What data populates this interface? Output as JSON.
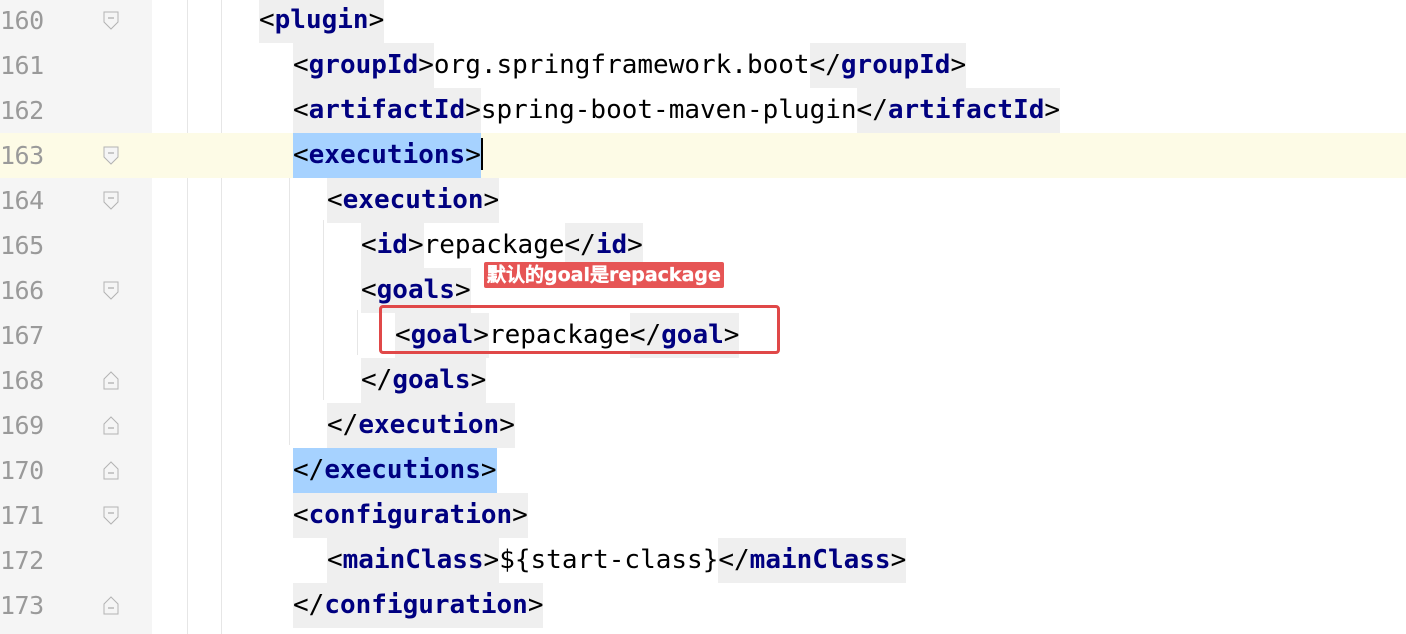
{
  "editor": {
    "current_line": "163",
    "lines": [
      {
        "num": "160",
        "fold": "open",
        "parts": [
          [
            "<",
            "punct"
          ],
          [
            "plugin",
            "tag"
          ],
          [
            ">",
            "punct"
          ]
        ]
      },
      {
        "num": "161",
        "fold": "none",
        "parts": [
          [
            "<",
            "punct"
          ],
          [
            "groupId",
            "tag"
          ],
          [
            ">",
            "punct"
          ],
          [
            "org.springframework.boot",
            "text"
          ],
          [
            "</",
            "punct"
          ],
          [
            "groupId",
            "tag"
          ],
          [
            ">",
            "punct"
          ]
        ]
      },
      {
        "num": "162",
        "fold": "none",
        "parts": [
          [
            "<",
            "punct"
          ],
          [
            "artifactId",
            "tag"
          ],
          [
            ">",
            "punct"
          ],
          [
            "spring-boot-maven-plugin",
            "text"
          ],
          [
            "</",
            "punct"
          ],
          [
            "artifactId",
            "tag"
          ],
          [
            ">",
            "punct"
          ]
        ]
      },
      {
        "num": "163",
        "fold": "open",
        "parts": [
          [
            "<",
            "punct"
          ],
          [
            "executions",
            "tag"
          ],
          [
            ">",
            "punct"
          ]
        ]
      },
      {
        "num": "164",
        "fold": "open",
        "parts": [
          [
            "<",
            "punct"
          ],
          [
            "execution",
            "tag"
          ],
          [
            ">",
            "punct"
          ]
        ]
      },
      {
        "num": "165",
        "fold": "none",
        "parts": [
          [
            "<",
            "punct"
          ],
          [
            "id",
            "tag"
          ],
          [
            ">",
            "punct"
          ],
          [
            "repackage",
            "text"
          ],
          [
            "</",
            "punct"
          ],
          [
            "id",
            "tag"
          ],
          [
            ">",
            "punct"
          ]
        ]
      },
      {
        "num": "166",
        "fold": "open",
        "parts": [
          [
            "<",
            "punct"
          ],
          [
            "goals",
            "tag"
          ],
          [
            ">",
            "punct"
          ]
        ]
      },
      {
        "num": "167",
        "fold": "none",
        "parts": [
          [
            "<",
            "punct"
          ],
          [
            "goal",
            "tag"
          ],
          [
            ">",
            "punct"
          ],
          [
            "repackage",
            "text"
          ],
          [
            "</",
            "punct"
          ],
          [
            "goal",
            "tag"
          ],
          [
            ">",
            "punct"
          ]
        ]
      },
      {
        "num": "168",
        "fold": "close",
        "parts": [
          [
            "</",
            "punct"
          ],
          [
            "goals",
            "tag"
          ],
          [
            ">",
            "punct"
          ]
        ]
      },
      {
        "num": "169",
        "fold": "close",
        "parts": [
          [
            "</",
            "punct"
          ],
          [
            "execution",
            "tag"
          ],
          [
            ">",
            "punct"
          ]
        ]
      },
      {
        "num": "170",
        "fold": "close",
        "parts": [
          [
            "</",
            "punct"
          ],
          [
            "executions",
            "tag"
          ],
          [
            ">",
            "punct"
          ]
        ]
      },
      {
        "num": "171",
        "fold": "open",
        "parts": [
          [
            "<",
            "punct"
          ],
          [
            "configuration",
            "tag"
          ],
          [
            ">",
            "punct"
          ]
        ]
      },
      {
        "num": "172",
        "fold": "none",
        "parts": [
          [
            "<",
            "punct"
          ],
          [
            "mainClass",
            "tag"
          ],
          [
            ">",
            "punct"
          ],
          [
            "${start-class}",
            "text"
          ],
          [
            "</",
            "punct"
          ],
          [
            "mainClass",
            "tag"
          ],
          [
            ">",
            "punct"
          ]
        ]
      },
      {
        "num": "173",
        "fold": "close",
        "parts": [
          [
            "</",
            "punct"
          ],
          [
            "configuration",
            "tag"
          ],
          [
            ">",
            "punct"
          ]
        ]
      }
    ]
  },
  "annotation": {
    "label": "默认的goal是repackage",
    "color": "#e04848"
  },
  "colors": {
    "tag": "#000080",
    "highlight": "#a6d2ff",
    "current_line": "#fdfbe6",
    "line_number": "#9a9a9a"
  }
}
